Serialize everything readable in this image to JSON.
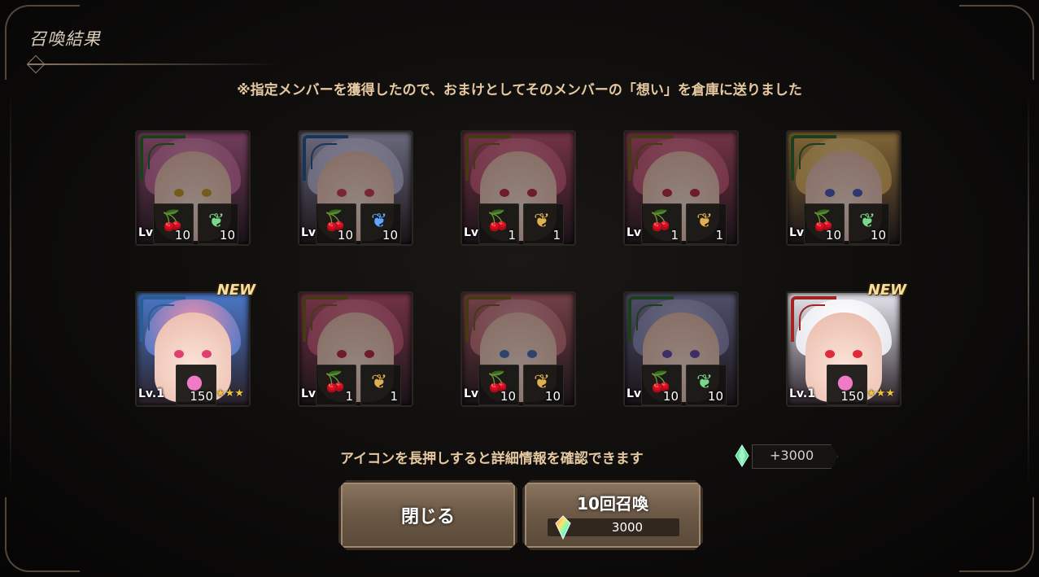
{
  "window": {
    "title": "召喚結果"
  },
  "notice": "※指定メンバーを獲得したので、おまけとしてそのメンバーの「想い」を倉庫に送りました",
  "colors": {
    "green_frame": "#2f6b2f",
    "blue_frame": "#2a5c96",
    "gold_frame": "#7a6323",
    "red_frame": "#a12525"
  },
  "cards": [
    {
      "frame": "green",
      "level": "Lv",
      "new": "",
      "items": [
        {
          "icon": "cherry-icon",
          "count": "10"
        },
        {
          "icon": "green-feather-icon",
          "count": "10"
        }
      ]
    },
    {
      "frame": "blue",
      "level": "Lv",
      "new": "",
      "items": [
        {
          "icon": "cherry-icon",
          "count": "10"
        },
        {
          "icon": "blue-feather-icon",
          "count": "10"
        }
      ]
    },
    {
      "frame": "gold",
      "level": "Lv",
      "new": "",
      "items": [
        {
          "icon": "cherry-icon",
          "count": "1"
        },
        {
          "icon": "gold-feather-icon",
          "count": "1"
        }
      ]
    },
    {
      "frame": "gold",
      "level": "Lv",
      "new": "",
      "items": [
        {
          "icon": "cherry-icon",
          "count": "1"
        },
        {
          "icon": "gold-feather-icon",
          "count": "1"
        }
      ]
    },
    {
      "frame": "green",
      "level": "Lv",
      "new": "",
      "items": [
        {
          "icon": "cherry-icon",
          "count": "10"
        },
        {
          "icon": "green-feather-icon",
          "count": "10"
        }
      ]
    },
    {
      "frame": "blue",
      "level": "Lv.1",
      "new": "NEW",
      "stars": "★★★",
      "items": [
        {
          "icon": "pink-orb-icon",
          "count": "150"
        }
      ]
    },
    {
      "frame": "gold",
      "level": "Lv",
      "new": "",
      "items": [
        {
          "icon": "cherry-icon",
          "count": "1"
        },
        {
          "icon": "gold-feather-icon",
          "count": "1"
        }
      ]
    },
    {
      "frame": "gold",
      "level": "Lv",
      "new": "",
      "items": [
        {
          "icon": "cherry-icon",
          "count": "10"
        },
        {
          "icon": "gold-feather-icon",
          "count": "10"
        }
      ]
    },
    {
      "frame": "green",
      "level": "Lv",
      "new": "",
      "items": [
        {
          "icon": "cherry-icon",
          "count": "10"
        },
        {
          "icon": "green-feather-icon",
          "count": "10"
        }
      ]
    },
    {
      "frame": "red",
      "level": "Lv.1",
      "new": "NEW",
      "stars": "★★★",
      "items": [
        {
          "icon": "pink-orb-icon",
          "count": "150"
        }
      ]
    }
  ],
  "hint": "アイコンを長押しすると詳細情報を確認できます",
  "reward": {
    "icon": "green-crystal-icon",
    "value": "+3000"
  },
  "buttons": {
    "close": "閉じる",
    "summon": {
      "label": "10回召喚",
      "cost_icon": "rainbow-crystal-icon",
      "cost": "3000"
    }
  }
}
